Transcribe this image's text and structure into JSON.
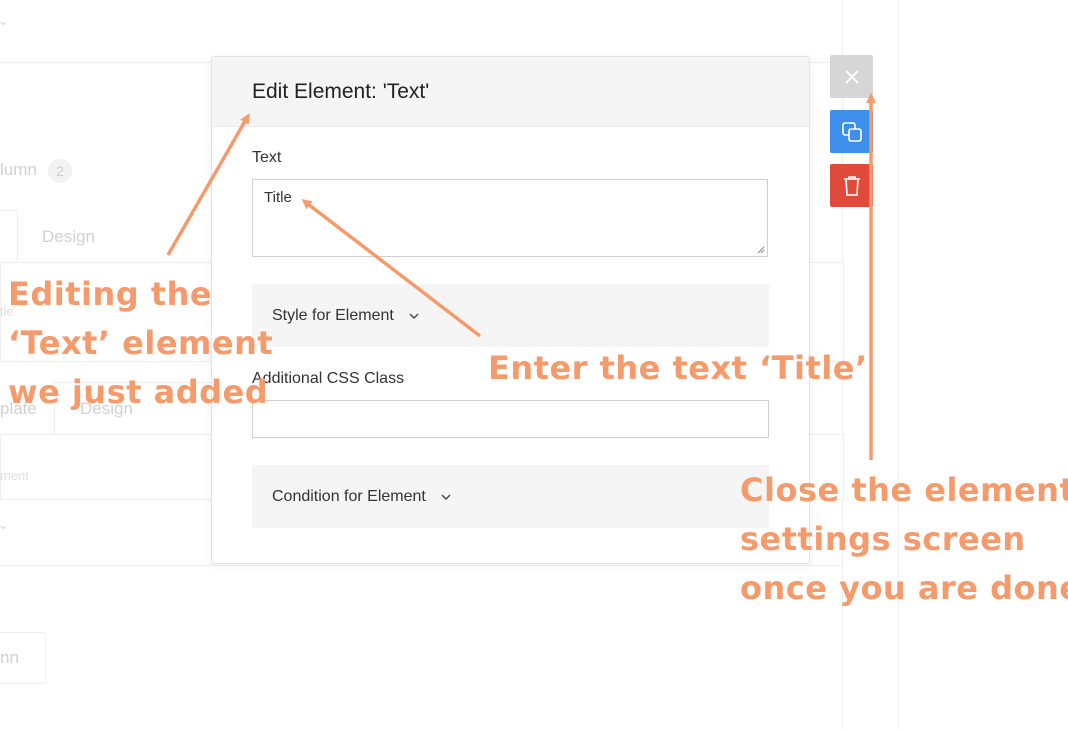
{
  "background": {
    "column_label": "lumn",
    "column_badge": "2",
    "tab_design": "Design",
    "tab_template": "plate",
    "tab_design_2": "Design",
    "row_hint_1": "tle",
    "row_hint_2": "ment",
    "add_button": "nn"
  },
  "modal": {
    "title": "Edit Element: 'Text'",
    "text_label": "Text",
    "text_value": "Title",
    "style_section": "Style for Element",
    "css_label": "Additional CSS Class",
    "css_value": "",
    "condition_section": "Condition for Element"
  },
  "side_actions": {
    "close_icon": "close-icon",
    "copy_icon": "copy-icon",
    "delete_icon": "trash-icon"
  },
  "annotations": {
    "editing": [
      "Editing the",
      "‘Text’ element",
      "we just added"
    ],
    "enter_text": "Enter the text ‘Title’",
    "close": [
      "Close the element",
      "settings screen",
      "once you are done"
    ]
  },
  "colors": {
    "annotation": "#f49a6b",
    "copy_button": "#3d8fec",
    "delete_button": "#e04a3a",
    "close_button": "#d6d6d6"
  }
}
